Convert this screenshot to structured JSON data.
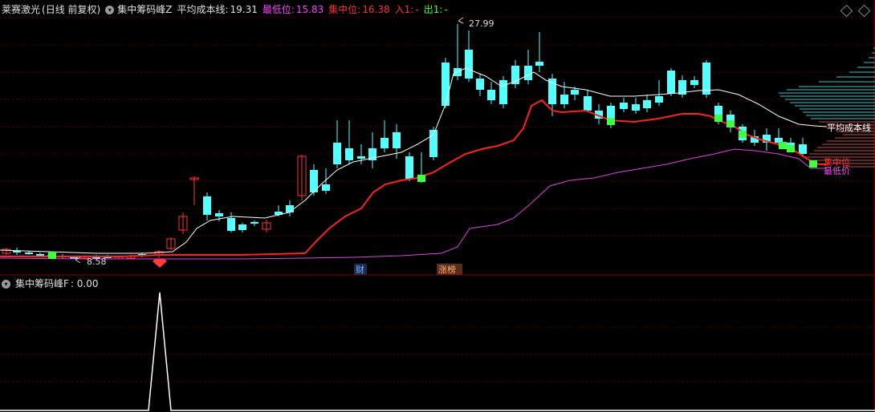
{
  "header": {
    "stock_name": "莱赛激光",
    "period": "(日线 前复权)",
    "indicator_name": "集中筹码峰Z",
    "avg_cost_label": "平均成本线:",
    "avg_cost_value": "19.31",
    "lowest_label": "最低位:",
    "lowest_value": "15.83",
    "center_label": "集中位:",
    "center_value": "16.38",
    "in_label": "入1:",
    "in_value": "-",
    "out_label": "出1:",
    "out_value": "-"
  },
  "sub_panel": {
    "indicator_name": "集中筹码峰F",
    "value": ": 0.00"
  },
  "annotations": {
    "high_price": "27.99",
    "low_price": "8.58",
    "marker_cai": "财",
    "marker_zhangbang": "涨榜",
    "avg_cost_line_label": "平均成本线",
    "center_line_label": "集中位",
    "lowest_line_label": "最低价"
  },
  "colors": {
    "up": "#ff3232",
    "down": "#54ffff",
    "avg_line": "#ffffff",
    "center_line": "#ff2020",
    "lowest_line": "#e040e0",
    "signal_green": "#40ff40",
    "grid": "#5a0000",
    "header_red": "#ff4040",
    "header_magenta": "#ff40ff",
    "header_green": "#40ff40"
  }
}
